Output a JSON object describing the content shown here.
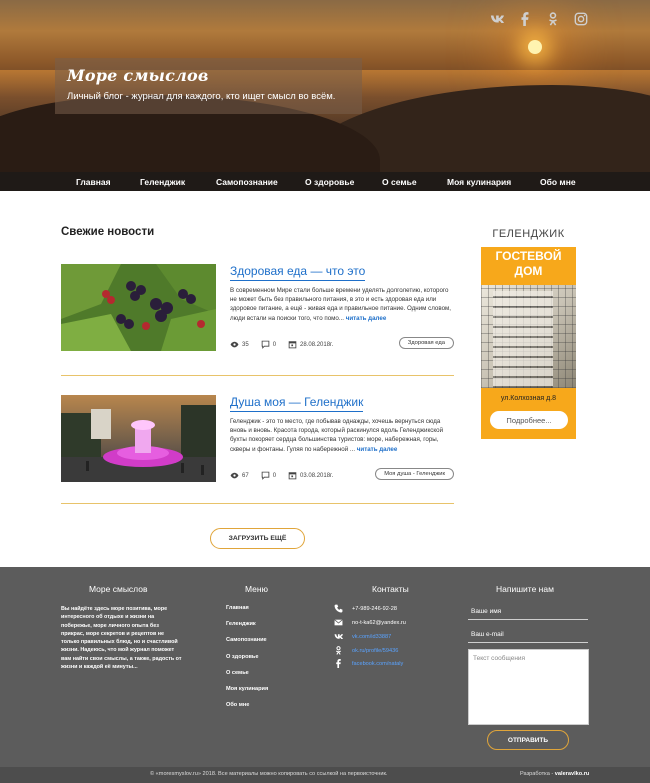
{
  "header": {
    "title": "Море смыслов",
    "subtitle": "Личный блог - журнал для каждого, кто ищет смысл во всём.",
    "socials": [
      "vk-icon",
      "facebook-icon",
      "odnoklassniki-icon",
      "instagram-icon"
    ]
  },
  "nav": {
    "items": [
      "Главная",
      "Геленджик",
      "Самопознание",
      "О здоровье",
      "О семье",
      "Моя кулинария",
      "Обо мне"
    ]
  },
  "main": {
    "section_title": "Свежие новости",
    "load_more": "ЗАГРУЗИТЬ ЕЩЁ",
    "posts": [
      {
        "title": "Здоровая еда — что это",
        "excerpt": "В современном Мире стали больше времени уделять долголетию, которого не может быть без правильного питания, в это и есть здоровая еда или здоровое питание, а ещё - живая еда и правильное питание. Одним словом, люди встали на поиски того, что помо...",
        "more": "читать далее",
        "views": "35",
        "comments": "0",
        "date": "28.08.2018г.",
        "tag": "Здоровая еда"
      },
      {
        "title": "Душа моя — Геленджик",
        "excerpt": "Геленджик - это то место, где побывав однажды, хочешь вернуться сюда вновь и вновь. Красота города, который раскинулся вдоль Геленджикской бухты покоряет сердца большинства туристов: море, набережная, горы, скверы и фонтаны. Гуляя по набережной ...",
        "more": "читать далее",
        "views": "67",
        "comments": "0",
        "date": "03.08.2018г.",
        "tag": "Моя душа - Геленджик"
      }
    ]
  },
  "sidebar": {
    "title": "ГЕЛЕНДЖИК",
    "ad_line1": "ГОСТЕВОЙ",
    "ad_line2": "ДОМ",
    "address": "ул.Колхозная д.8",
    "button": "Подробнее..."
  },
  "footer": {
    "about_title": "Море смыслов",
    "about_text": "Вы найдёте здесь море позитива, море интересного об отдыхе и жизни на побережье, море личного опыта без прикрас, море секретов и рецептов не только правильных блюд, но и счастливой жизни. Надеюсь, что мой журнал поможет вам найти свои смыслы, а также, радость от жизни и каждой её минуты...",
    "menu_title": "Меню",
    "menu": [
      "Главная",
      "Геленджик",
      "Самопознание",
      "О здоровье",
      "О семье",
      "Моя кулинария",
      "Обо мне"
    ],
    "contacts_title": "Контакты",
    "contacts": [
      {
        "icon": "phone-icon",
        "text": "+7-989-246-92-28",
        "link": false
      },
      {
        "icon": "mail-icon",
        "text": "no-t-ka62@yandex.ru",
        "link": false
      },
      {
        "icon": "vk-icon",
        "text": "vk.com/id33887",
        "link": true
      },
      {
        "icon": "odnoklassniki-icon",
        "text": "ok.ru/profile/59436",
        "link": true
      },
      {
        "icon": "facebook-icon",
        "text": "facebook.com/nataly",
        "link": true
      }
    ],
    "form_title": "Напишите нам",
    "name_placeholder": "Ваше имя",
    "email_placeholder": "Ваш e-mail",
    "message_placeholder": "Текст сообщения",
    "send": "ОТПРАВИТЬ"
  },
  "bottom": {
    "copyright": "© «moresmyslov.ru» 2018. Все материалы можно копировать со ссылкой на первоисточник.",
    "dev_label": "Разработка - ",
    "dev_name": "valeravlko.ru"
  },
  "colors": {
    "accent": "#f7a81b",
    "link": "#1e6fc9",
    "footer": "#5c5c5c"
  }
}
